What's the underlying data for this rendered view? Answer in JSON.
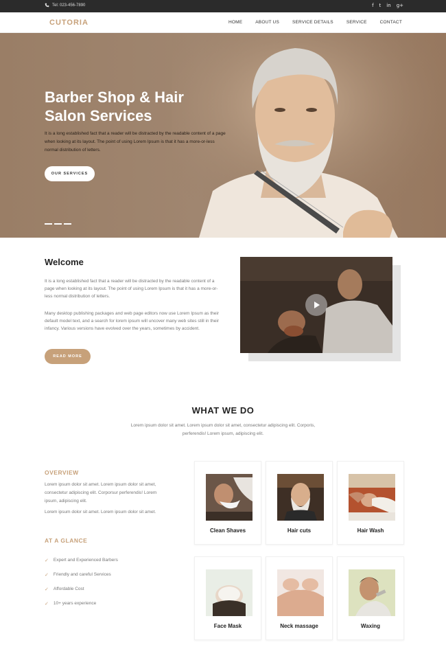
{
  "topbar": {
    "phone": "Tel: 023-456-7890",
    "socials": [
      {
        "icon": "facebook-icon",
        "glyph": "f"
      },
      {
        "icon": "twitter-icon",
        "glyph": "t"
      },
      {
        "icon": "linkedin-icon",
        "glyph": "in"
      },
      {
        "icon": "google-plus-icon",
        "glyph": "g+"
      }
    ]
  },
  "nav": {
    "logo": "CUTORIA",
    "items": [
      "HOME",
      "ABOUT US",
      "SERVICE DETAILS",
      "SERVICE",
      "CONTACT"
    ]
  },
  "hero": {
    "title": "Barber Shop & Hair Salon Services",
    "text": "It is a long established fact that a reader will be distracted by the readable content of a page when looking at its layout. The point of using Lorem Ipsum is that it has a more-or-less normal distribution of letters.",
    "button": "OUR SERVICES"
  },
  "welcome": {
    "title": "Welcome",
    "p1": "It is a long established fact that a reader will be distracted by the readable content of a page when looking at its layout. The point of using Lorem Ipsum is that it has a more-or-less normal distribution of letters.",
    "p2": "Many desktop publishing packages and web page editors now use Lorem Ipsum as their default model text, and a search for lorem ipsum will uncover many web sites still in their infancy. Various versions have evolved over the years, sometimes by accident.",
    "button": "READ MORE"
  },
  "whatwedo": {
    "title": "WHAT WE DO",
    "subtitle": "Lorem ipsum dolor sit amet. Lorem ipsum dolor sit amet, consectetur adipiscing elit. Corporis, perferendis! Lorem ipsum, adipiscing elit."
  },
  "overview": {
    "title": "OVERVIEW",
    "p1": "Lorem ipsum dolor sit amet. Lorem ipsum dolor sit amet, consectetur adipiscing elit. Corporsur perferendis! Lorem ipsum, adipiscing elit.",
    "p2": "Lorem ipsum dolor sit amet. Lorem ipsum dolor sit amet."
  },
  "glance": {
    "title": "AT A GLANCE",
    "items": [
      "Expert and Experienced Barbers",
      "Friendly and careful Services",
      "Affordable Cost",
      "10+ years experience"
    ]
  },
  "services": [
    "Clean Shaves",
    "Hair cuts",
    "Hair Wash",
    "Face Mask",
    "Neck massage",
    "Waxing"
  ],
  "colors": {
    "accent": "#c7a17a",
    "topbar": "#2b2b2b",
    "hero": "#9a7e66"
  }
}
